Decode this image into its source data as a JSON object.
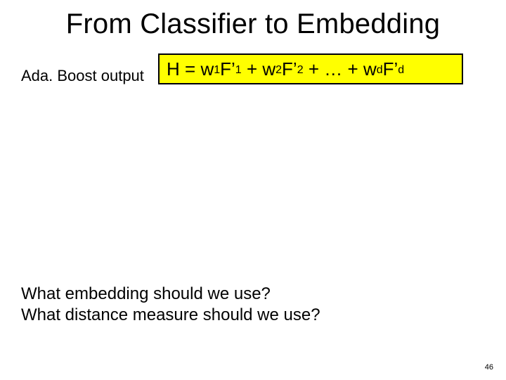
{
  "slide": {
    "title": "From Classifier to Embedding",
    "label": "Ada. Boost output",
    "formula": {
      "lhs": "H",
      "eq": "=",
      "terms": [
        {
          "w": "w",
          "wi": "1",
          "F": "F’",
          "fi": "1"
        },
        {
          "w": "w",
          "wi": "2",
          "F": "F’",
          "fi": "2"
        },
        {
          "w": "w",
          "wi": "d",
          "F": "F’",
          "fi": "d"
        }
      ],
      "plus": "+",
      "ellipsis": "…"
    },
    "question1": "What embedding should we use?",
    "question2": "What distance measure should we use?",
    "page": "46"
  }
}
